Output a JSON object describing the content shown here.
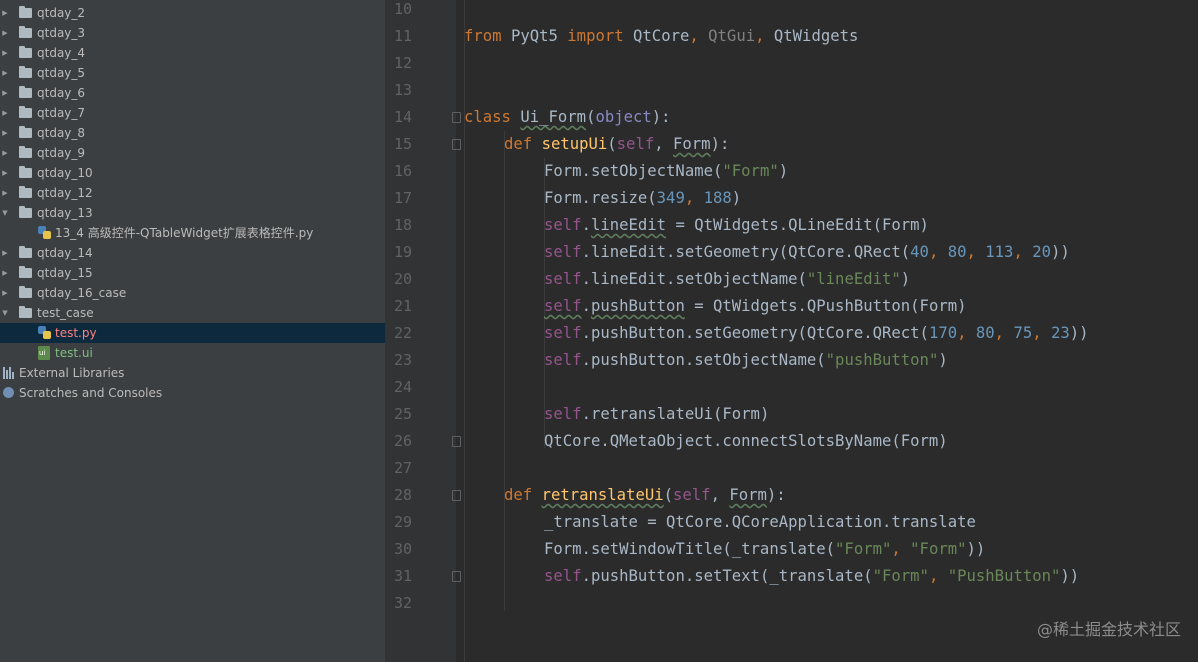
{
  "project_tree": {
    "folders": [
      {
        "label": "qtday_2",
        "expanded": false
      },
      {
        "label": "qtday_3",
        "expanded": false
      },
      {
        "label": "qtday_4",
        "expanded": false
      },
      {
        "label": "qtday_5",
        "expanded": false
      },
      {
        "label": "qtday_6",
        "expanded": false
      },
      {
        "label": "qtday_7",
        "expanded": false
      },
      {
        "label": "qtday_8",
        "expanded": false
      },
      {
        "label": "qtday_9",
        "expanded": false
      },
      {
        "label": "qtday_10",
        "expanded": false
      },
      {
        "label": "qtday_12",
        "expanded": false
      },
      {
        "label": "qtday_13",
        "expanded": true
      },
      {
        "label": "13_4 高级控件-QTableWidget扩展表格控件.py",
        "type": "py"
      },
      {
        "label": "qtday_14",
        "expanded": false
      },
      {
        "label": "qtday_15",
        "expanded": false
      },
      {
        "label": "qtday_16_case",
        "expanded": false
      },
      {
        "label": "test_case",
        "expanded": true
      },
      {
        "label": "test.py",
        "type": "py",
        "selected": true
      },
      {
        "label": "test.ui",
        "type": "ui"
      },
      {
        "label": "External Libraries",
        "type": "libs"
      },
      {
        "label": "Scratches and Consoles",
        "type": "scratch"
      }
    ]
  },
  "editor": {
    "line_numbers": [
      "10",
      "11",
      "12",
      "13",
      "14",
      "15",
      "16",
      "17",
      "18",
      "19",
      "20",
      "21",
      "22",
      "23",
      "24",
      "25",
      "26",
      "27",
      "28",
      "29",
      "30",
      "31",
      "32"
    ],
    "lines": {
      "l11": {
        "from": "from",
        "mod": "PyQt5",
        "imp": "import",
        "a": "QtCore",
        "c1": ",",
        "b": "QtGui",
        "c2": ",",
        "c": "QtWidgets"
      },
      "l14": {
        "kw": "class",
        "name": "Ui_Form",
        "args": "object",
        "p1": "(",
        "p2": "):"
      },
      "l15": {
        "kw": "def",
        "name": "setupUi",
        "self": "self",
        "rest": ", ",
        "form": "Form",
        "end": "):"
      },
      "l16": {
        "a": "Form.setObjectName(",
        "s": "\"Form\"",
        "b": ")"
      },
      "l17": {
        "a": "Form.resize(",
        "n1": "349",
        "c": ", ",
        "n2": "188",
        "b": ")"
      },
      "l18": {
        "self": "self",
        "a": ".",
        "b": "lineEdit",
        "c": " = QtWidgets.QLineEdit(Form)"
      },
      "l19": {
        "self": "self",
        "a": ".lineEdit.setGeometry(QtCore.QRect(",
        "n1": "40",
        "c1": ", ",
        "n2": "80",
        "c2": ", ",
        "n3": "113",
        "c3": ", ",
        "n4": "20",
        "b": "))"
      },
      "l20": {
        "self": "self",
        "a": ".lineEdit.setObjectName(",
        "s": "\"lineEdit\"",
        "b": ")"
      },
      "l21": {
        "self": "self",
        "a": ".",
        "b": "pushButton",
        "c": " = QtWidgets.QPushButton(Form)"
      },
      "l22": {
        "self": "self",
        "a": ".pushButton.setGeometry(QtCore.QRect(",
        "n1": "170",
        "c1": ", ",
        "n2": "80",
        "c2": ", ",
        "n3": "75",
        "c3": ", ",
        "n4": "23",
        "b": "))"
      },
      "l23": {
        "self": "self",
        "a": ".pushButton.setObjectName(",
        "s": "\"pushButton\"",
        "b": ")"
      },
      "l25": {
        "self": "self",
        "a": ".retranslateUi(Form)"
      },
      "l26": {
        "a": "QtCore.QMetaObject.connectSlotsByName(Form)"
      },
      "l28": {
        "kw": "def",
        "name": "retranslateUi",
        "self": "self",
        "rest": ", ",
        "form": "Form",
        "end": "):"
      },
      "l29": {
        "a": "_translate = QtCore.QCoreApplication.translate"
      },
      "l30": {
        "a": "Form.setWindowTitle(_translate(",
        "s1": "\"Form\"",
        "c": ", ",
        "s2": "\"Form\"",
        "b": "))"
      },
      "l31": {
        "self": "self",
        "a": ".pushButton.setText(_translate(",
        "s1": "\"Form\"",
        "c": ", ",
        "s2": "\"PushButton\"",
        "b": "))"
      }
    }
  },
  "watermark": "@稀土掘金技术社区",
  "colors": {
    "keyword": "#cc7832",
    "string": "#6a8759",
    "number": "#6897bb",
    "self": "#94558d",
    "function": "#ffc66d",
    "selection": "#0d293e"
  }
}
